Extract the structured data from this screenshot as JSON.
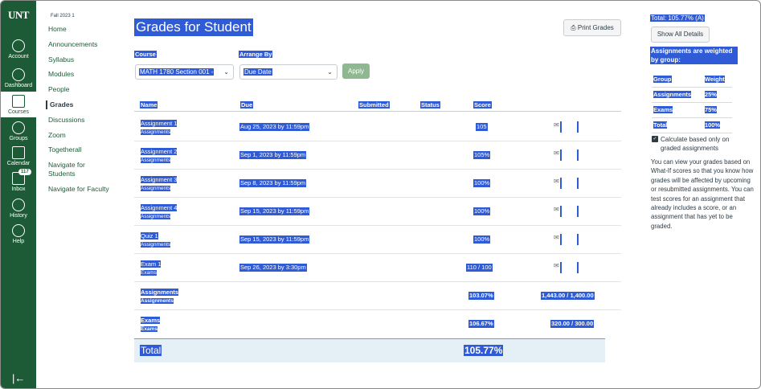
{
  "global_nav": {
    "logo": "UNT",
    "items": [
      {
        "label": "Account",
        "icon": "account-icon"
      },
      {
        "label": "Dashboard",
        "icon": "dashboard-icon"
      },
      {
        "label": "Courses",
        "icon": "courses-icon"
      },
      {
        "label": "Groups",
        "icon": "groups-icon"
      },
      {
        "label": "Calendar",
        "icon": "calendar-icon"
      },
      {
        "label": "Inbox",
        "icon": "inbox-icon",
        "badge": "117"
      },
      {
        "label": "History",
        "icon": "history-icon"
      },
      {
        "label": "Help",
        "icon": "help-icon"
      }
    ],
    "collapse_glyph": "|←"
  },
  "course_nav": {
    "term": "Fall 2023 1",
    "items": [
      "Home",
      "Announcements",
      "Syllabus",
      "Modules",
      "People",
      "Grades",
      "Discussions",
      "Zoom",
      "Togetherall",
      "Navigate for Students",
      "Navigate for Faculty"
    ]
  },
  "page": {
    "title": "Grades for Student",
    "print_label": "Print Grades",
    "course_label": "Course",
    "course_value": "MATH 1780 Section 001 -",
    "arrange_label": "Arrange By",
    "arrange_value": "Due Date",
    "apply_label": "Apply"
  },
  "table": {
    "headers": [
      "Name",
      "Due",
      "Submitted",
      "Status",
      "Score"
    ],
    "rows": [
      {
        "name": "Assignment 1",
        "group": "Assignments",
        "due": "Aug 25, 2023 by 11:59pm",
        "score": "105"
      },
      {
        "name": "Assignment 2",
        "group": "Assignments",
        "due": "Sep 1, 2023 by 11:59pm",
        "score": "105%"
      },
      {
        "name": "Assignment 3",
        "group": "Assignments",
        "due": "Sep 8, 2023 by 11:59pm",
        "score": "100%"
      },
      {
        "name": "Assignment 4",
        "group": "Assignments",
        "due": "Sep 15, 2023 by 11:59pm",
        "score": "100%"
      },
      {
        "name": "Quiz 1",
        "group": "Assignments",
        "due": "Sep 15, 2023 by 11:59pm",
        "score": "100%"
      },
      {
        "name": "Exam 1",
        "group": "Exams",
        "due": "Sep 26, 2023 by 3:30pm",
        "score": "110 / 100"
      }
    ],
    "groups": [
      {
        "name": "Assignments",
        "sub": "Assignments",
        "score": "103.07%",
        "points": "1,443.00 / 1,400.00"
      },
      {
        "name": "Exams",
        "sub": "Exams",
        "score": "106.67%",
        "points": "320.00 / 300.00"
      }
    ],
    "total_label": "Total",
    "total_score": "105.77%"
  },
  "sidebar": {
    "total": "Total: 105.77% (A)",
    "show_all": "Show All Details",
    "weighted_note": "Assignments are weighted by group:",
    "weights_header": [
      "Group",
      "Weight"
    ],
    "weights": [
      {
        "group": "Assignments",
        "weight": "25%"
      },
      {
        "group": "Exams",
        "weight": "75%"
      },
      {
        "group": "Total",
        "weight": "100%"
      }
    ],
    "checkbox_label": "Calculate based only on graded assignments",
    "whatif_text": "You can view your grades based on What-If scores so that you know how grades will be affected by upcoming or resubmitted assignments. You can test scores for an assignment that already includes a score, or an assignment that has yet to be graded."
  },
  "colors": {
    "nav_green": "#1d5b36",
    "highlight": "#2f5cd6",
    "apply": "#8eb890"
  }
}
